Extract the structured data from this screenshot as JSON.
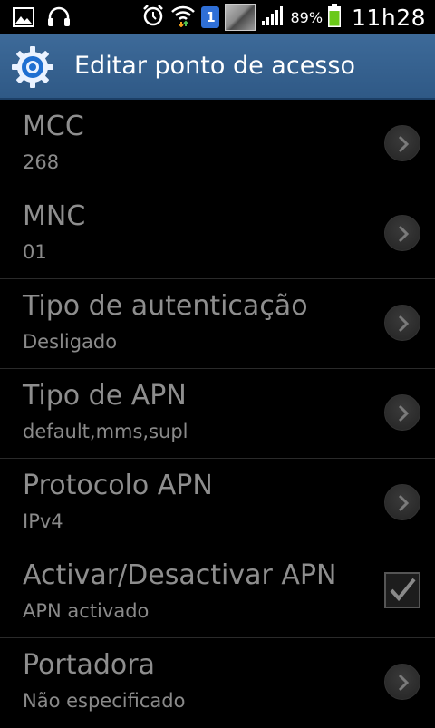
{
  "status_bar": {
    "icons_left": [
      "image-icon",
      "headset-icon"
    ],
    "icons_right": [
      "alarm-icon",
      "wifi-icon",
      "sim-badge",
      "screenshot-thumbnail",
      "signal-icon",
      "battery-icon"
    ],
    "sim_number": "1",
    "battery_percent": "89%",
    "battery_level": 0.89,
    "time": "11h28"
  },
  "header": {
    "title": "Editar ponto de acesso",
    "icon": "settings-gear-icon"
  },
  "items": [
    {
      "title": "MCC",
      "value": "268",
      "control": "chevron"
    },
    {
      "title": "MNC",
      "value": "01",
      "control": "chevron"
    },
    {
      "title": "Tipo de autenticação",
      "value": "Desligado",
      "control": "chevron"
    },
    {
      "title": "Tipo de APN",
      "value": "default,mms,supl",
      "control": "chevron"
    },
    {
      "title": "Protocolo APN",
      "value": "IPv4",
      "control": "chevron"
    },
    {
      "title": "Activar/Desactivar APN",
      "value": "APN activado",
      "control": "checkbox",
      "checked": true
    },
    {
      "title": "Portadora",
      "value": "Não especificado",
      "control": "chevron"
    }
  ]
}
